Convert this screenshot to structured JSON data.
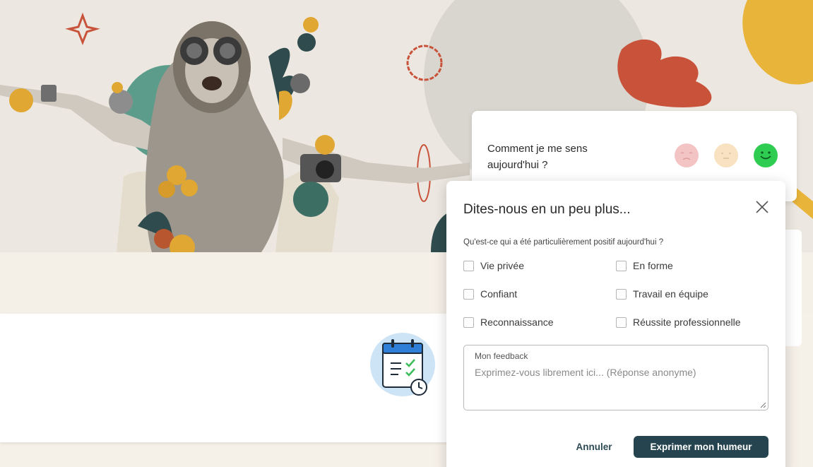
{
  "mood_card": {
    "question": "Comment je me sens aujourd'hui ?",
    "faces": [
      {
        "name": "sad-face-icon",
        "color": "#f3c4c4"
      },
      {
        "name": "neutral-face-icon",
        "color": "#f8e2c2"
      },
      {
        "name": "happy-face-icon",
        "color": "#2ecc50"
      }
    ]
  },
  "modal": {
    "title": "Dites-nous en un peu plus...",
    "question": "Qu'est-ce qui a été particulièrement positif aujourd'hui ?",
    "options": [
      {
        "label": "Vie privée",
        "checked": false
      },
      {
        "label": "En forme",
        "checked": false
      },
      {
        "label": "Confiant",
        "checked": false
      },
      {
        "label": "Travail en équipe",
        "checked": false
      },
      {
        "label": "Reconnaissance",
        "checked": false
      },
      {
        "label": "Réussite professionnelle",
        "checked": false
      }
    ],
    "feedback": {
      "label": "Mon feedback",
      "placeholder": "Exprimez-vous librement ici... (Réponse anonyme)",
      "value": ""
    },
    "cancel_label": "Annuler",
    "submit_label": "Exprimer mon humeur"
  },
  "colors": {
    "accent": "#25444f",
    "background": "#f5f0e8",
    "happy": "#2ecc50"
  }
}
